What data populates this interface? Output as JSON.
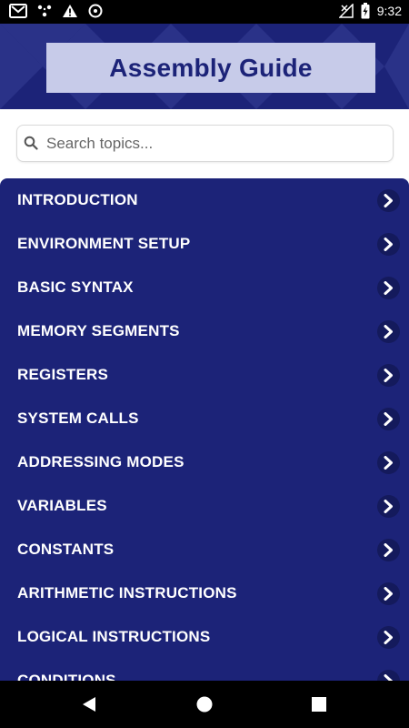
{
  "status_bar": {
    "time": "9:32",
    "icons": [
      "gmail-icon",
      "signal-dots-icon",
      "warning-icon",
      "sync-icon"
    ],
    "right_icons": [
      "no-signal-icon",
      "battery-charging-icon"
    ]
  },
  "header": {
    "title": "Assembly Guide"
  },
  "search": {
    "placeholder": "Search topics..."
  },
  "topics": [
    "INTRODUCTION",
    "ENVIRONMENT SETUP",
    "BASIC SYNTAX",
    "MEMORY SEGMENTS",
    "REGISTERS",
    "SYSTEM CALLS",
    "ADDRESSING MODES",
    "VARIABLES",
    "CONSTANTS",
    "ARITHMETIC INSTRUCTIONS",
    "LOGICAL INSTRUCTIONS",
    "CONDITIONS"
  ],
  "colors": {
    "primary": "#1c2378",
    "title_box": "#c7cbe9",
    "chevron_bg": "#141a5c"
  },
  "nav_bar": {
    "buttons": [
      "back-icon",
      "home-icon",
      "recents-icon"
    ]
  }
}
